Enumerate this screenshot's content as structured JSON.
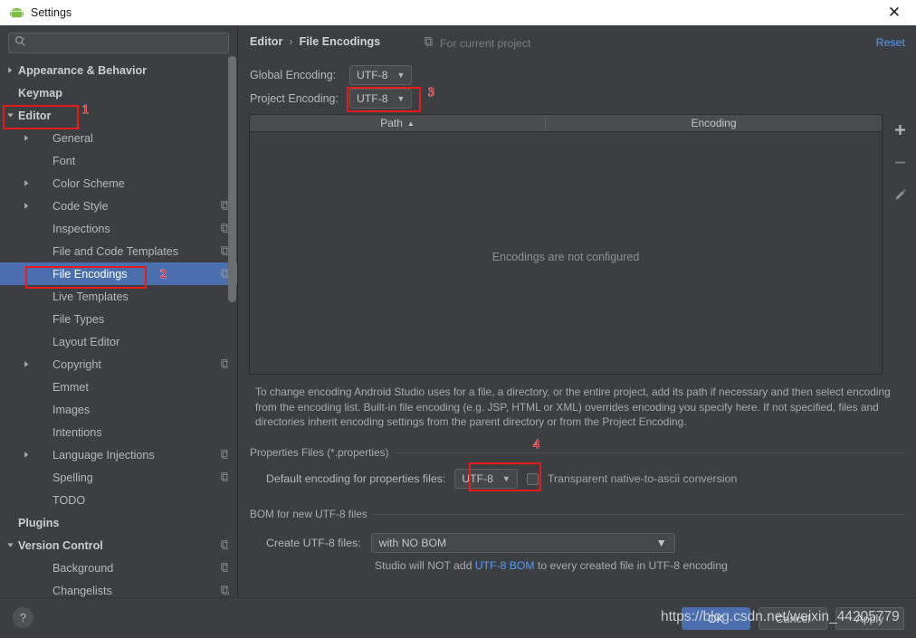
{
  "window": {
    "title": "Settings",
    "app_icon": "android-icon",
    "close_icon": "close-icon"
  },
  "search": {
    "placeholder": "",
    "value": "",
    "icon": "search-icon"
  },
  "sidebar": {
    "items": [
      {
        "label": "Appearance & Behavior",
        "indent": 0,
        "arrow": "right",
        "bold": true,
        "selected": false,
        "config_icon": false
      },
      {
        "label": "Keymap",
        "indent": 0,
        "arrow": "none",
        "bold": true,
        "selected": false,
        "config_icon": false
      },
      {
        "label": "Editor",
        "indent": 0,
        "arrow": "down",
        "bold": true,
        "selected": false,
        "config_icon": false
      },
      {
        "label": "General",
        "indent": 1,
        "arrow": "right",
        "bold": false,
        "selected": false,
        "config_icon": false
      },
      {
        "label": "Font",
        "indent": 1,
        "arrow": "none",
        "bold": false,
        "selected": false,
        "config_icon": false
      },
      {
        "label": "Color Scheme",
        "indent": 1,
        "arrow": "right",
        "bold": false,
        "selected": false,
        "config_icon": false
      },
      {
        "label": "Code Style",
        "indent": 1,
        "arrow": "right",
        "bold": false,
        "selected": false,
        "config_icon": true
      },
      {
        "label": "Inspections",
        "indent": 1,
        "arrow": "none",
        "bold": false,
        "selected": false,
        "config_icon": true
      },
      {
        "label": "File and Code Templates",
        "indent": 1,
        "arrow": "none",
        "bold": false,
        "selected": false,
        "config_icon": true
      },
      {
        "label": "File Encodings",
        "indent": 1,
        "arrow": "none",
        "bold": false,
        "selected": true,
        "config_icon": true
      },
      {
        "label": "Live Templates",
        "indent": 1,
        "arrow": "none",
        "bold": false,
        "selected": false,
        "config_icon": false
      },
      {
        "label": "File Types",
        "indent": 1,
        "arrow": "none",
        "bold": false,
        "selected": false,
        "config_icon": false
      },
      {
        "label": "Layout Editor",
        "indent": 1,
        "arrow": "none",
        "bold": false,
        "selected": false,
        "config_icon": false
      },
      {
        "label": "Copyright",
        "indent": 1,
        "arrow": "right",
        "bold": false,
        "selected": false,
        "config_icon": true
      },
      {
        "label": "Emmet",
        "indent": 1,
        "arrow": "none",
        "bold": false,
        "selected": false,
        "config_icon": false
      },
      {
        "label": "Images",
        "indent": 1,
        "arrow": "none",
        "bold": false,
        "selected": false,
        "config_icon": false
      },
      {
        "label": "Intentions",
        "indent": 1,
        "arrow": "none",
        "bold": false,
        "selected": false,
        "config_icon": false
      },
      {
        "label": "Language Injections",
        "indent": 1,
        "arrow": "right",
        "bold": false,
        "selected": false,
        "config_icon": true
      },
      {
        "label": "Spelling",
        "indent": 1,
        "arrow": "none",
        "bold": false,
        "selected": false,
        "config_icon": true
      },
      {
        "label": "TODO",
        "indent": 1,
        "arrow": "none",
        "bold": false,
        "selected": false,
        "config_icon": false
      },
      {
        "label": "Plugins",
        "indent": 0,
        "arrow": "none",
        "bold": true,
        "selected": false,
        "config_icon": false
      },
      {
        "label": "Version Control",
        "indent": 0,
        "arrow": "down",
        "bold": true,
        "selected": false,
        "config_icon": true
      },
      {
        "label": "Background",
        "indent": 1,
        "arrow": "none",
        "bold": false,
        "selected": false,
        "config_icon": true
      },
      {
        "label": "Changelists",
        "indent": 1,
        "arrow": "none",
        "bold": false,
        "selected": false,
        "config_icon": true
      }
    ]
  },
  "main": {
    "breadcrumb": {
      "parent": "Editor",
      "separator": "›",
      "current": "File Encodings"
    },
    "for_current_project": "For current project",
    "reset_label": "Reset",
    "global_encoding": {
      "label": "Global Encoding:",
      "value": "UTF-8"
    },
    "project_encoding": {
      "label": "Project Encoding:",
      "value": "UTF-8"
    },
    "table": {
      "columns": [
        "Path",
        "Encoding"
      ],
      "sort_indicator": "▲",
      "rows": [],
      "empty_message": "Encodings are not configured",
      "tools": [
        "add-icon",
        "remove-icon",
        "edit-icon"
      ]
    },
    "description": "To change encoding Android Studio uses for a file, a directory, or the entire project, add its path if necessary and then select encoding from the encoding list. Built-in file encoding (e.g. JSP, HTML or XML) overrides encoding you specify here. If not specified, files and directories inherit encoding settings from the parent directory or from the Project Encoding.",
    "properties_group": {
      "title": "Properties Files (*.properties)",
      "default_encoding_label": "Default encoding for properties files:",
      "default_encoding_value": "UTF-8",
      "transparent_checkbox_label": "Transparent native-to-ascii conversion",
      "transparent_checked": false
    },
    "bom_group": {
      "title": "BOM for new UTF-8 files",
      "create_label": "Create UTF-8 files:",
      "create_value": "with NO BOM",
      "note_prefix": "Studio will NOT add ",
      "note_link": "UTF-8 BOM",
      "note_suffix": " to every created file in UTF-8 encoding"
    }
  },
  "footer": {
    "help_label": "?",
    "ok_label": "OK",
    "cancel_label": "Cancel",
    "apply_label": "Apply"
  },
  "watermark": {
    "text": "https://blog.csdn.net/weixin_44205779"
  },
  "annotations": {
    "markers": [
      {
        "number": "1",
        "target": "sidebar-editor"
      },
      {
        "number": "2",
        "target": "sidebar-file-encodings"
      },
      {
        "number": "3",
        "target": "project-encoding-combo"
      },
      {
        "number": "4",
        "target": "properties-default-encoding-combo"
      }
    ],
    "color": "#e81b1b"
  },
  "colors": {
    "accent": "#4b6eaf",
    "link": "#589df6",
    "background": "#3c3f41",
    "annotation": "#e81b1b"
  }
}
